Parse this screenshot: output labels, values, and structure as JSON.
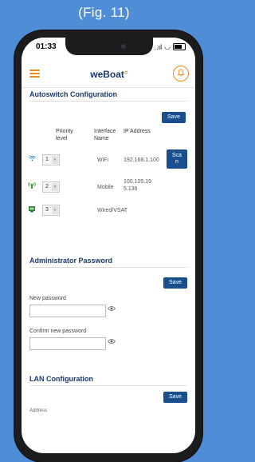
{
  "caption": "(Fig. 11)",
  "status": {
    "time": "01:33",
    "signal": "..ıl",
    "wifi": "◡"
  },
  "app": {
    "logo_main": "weBoat",
    "logo_mark": "°"
  },
  "autoswitch": {
    "title": "Autoswitch Configuration",
    "save_label": "Save",
    "headers": {
      "priority": "Priority level",
      "interface": "Interface Name",
      "ip": "IP Address"
    },
    "rows": [
      {
        "priority": "1",
        "interface": "WiFi",
        "ip": "192.168.1.100",
        "icon": "wifi-icon"
      },
      {
        "priority": "2",
        "interface": "Mobile",
        "ip": "100.105.195.136",
        "icon": "mobile-signal-icon"
      },
      {
        "priority": "3",
        "interface": "Wired/VSAT",
        "ip": "-",
        "icon": "ethernet-icon"
      }
    ],
    "scan_label": "Scan"
  },
  "admin": {
    "title": "Administrator Password",
    "save_label": "Save",
    "new_password_label": "New password",
    "confirm_password_label": "Confirm new password"
  },
  "lan": {
    "title": "LAN Configuration",
    "save_label": "Save",
    "address_label": "Address"
  },
  "colors": {
    "accent": "#f08a1c",
    "primary": "#1a4f8e",
    "background": "#4f8ed6"
  }
}
